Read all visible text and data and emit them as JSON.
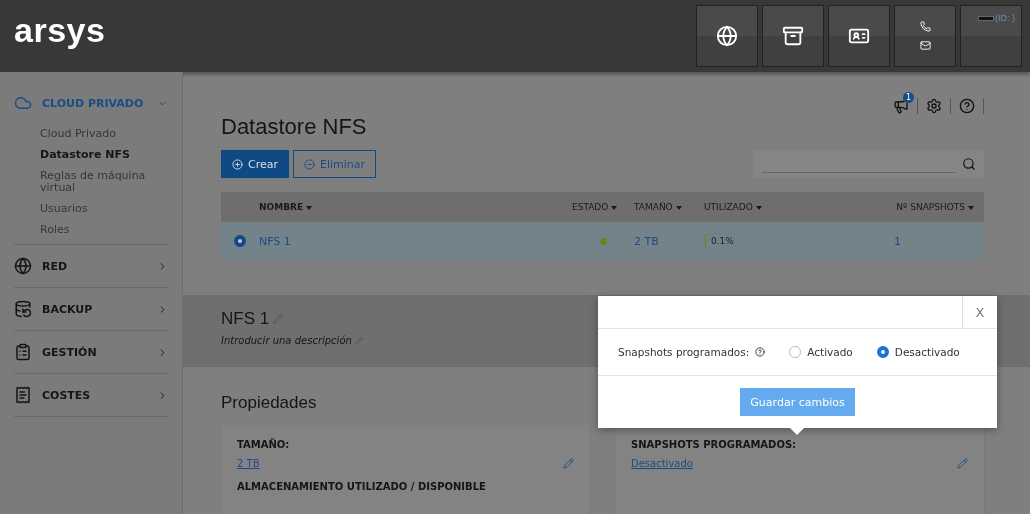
{
  "header": {
    "logo": "arsys",
    "buttons": [
      {
        "kind": "globe"
      },
      {
        "kind": "archive"
      },
      {
        "kind": "contact"
      },
      {
        "kind": "phone-mail"
      },
      {
        "kind": "account",
        "id_label": "(ID: )"
      }
    ]
  },
  "sidebar": {
    "sections": [
      {
        "label": "CLOUD PRIVADO",
        "kind": "cloud",
        "selected": true,
        "expanded": true,
        "children": [
          {
            "label": "Cloud Privado",
            "selected": false
          },
          {
            "label": "Datastore NFS",
            "selected": true
          },
          {
            "label": "Reglas de máquina virtual",
            "selected": false
          },
          {
            "label": "Usuarios",
            "selected": false
          },
          {
            "label": "Roles",
            "selected": false
          }
        ]
      },
      {
        "label": "RED",
        "kind": "network",
        "selected": false,
        "expanded": false
      },
      {
        "label": "BACKUP",
        "kind": "backup",
        "selected": false,
        "expanded": false
      },
      {
        "label": "GESTIÓN",
        "kind": "management",
        "selected": false,
        "expanded": false
      },
      {
        "label": "COSTES",
        "kind": "costs",
        "selected": false,
        "expanded": false
      }
    ]
  },
  "toolbar": {
    "notifications": "1"
  },
  "page_title": "Datastore NFS",
  "actions": [
    {
      "label": "Crear",
      "kind": "primary"
    },
    {
      "label": "Eliminar",
      "kind": "secondary"
    }
  ],
  "table": {
    "columns": [
      "NOMBRE",
      "ESTADO",
      "TAMAÑO",
      "UTILIZADO",
      "Nº SNAPSHOTS"
    ],
    "rows": [
      {
        "selected": true,
        "name": "NFS 1",
        "color": "#5f8a1c",
        "size": "2 TB",
        "used_reading": "0.1%",
        "level": 0.001,
        "snapshots": "1"
      }
    ]
  },
  "detail": {
    "name": "NFS 1",
    "description": "Introducir una descripción"
  },
  "properties": {
    "title": "Propiedades",
    "cards": [
      {
        "items": [
          {
            "label": "TAMAÑO:",
            "value": "2 TB"
          },
          {
            "label": "ALMACENAMIENTO UTILIZADO / DISPONIBLE"
          }
        ]
      },
      {
        "items": [
          {
            "label": "SNAPSHOTS PROGRAMADOS:",
            "value": "Desactivado"
          }
        ]
      }
    ]
  },
  "popover": {
    "close": "X",
    "field_label": "Snapshots programados:",
    "options": [
      {
        "label": "Activado",
        "selected": false
      },
      {
        "label": "Desactivado",
        "selected": true
      }
    ],
    "button": "Guardar cambios"
  }
}
